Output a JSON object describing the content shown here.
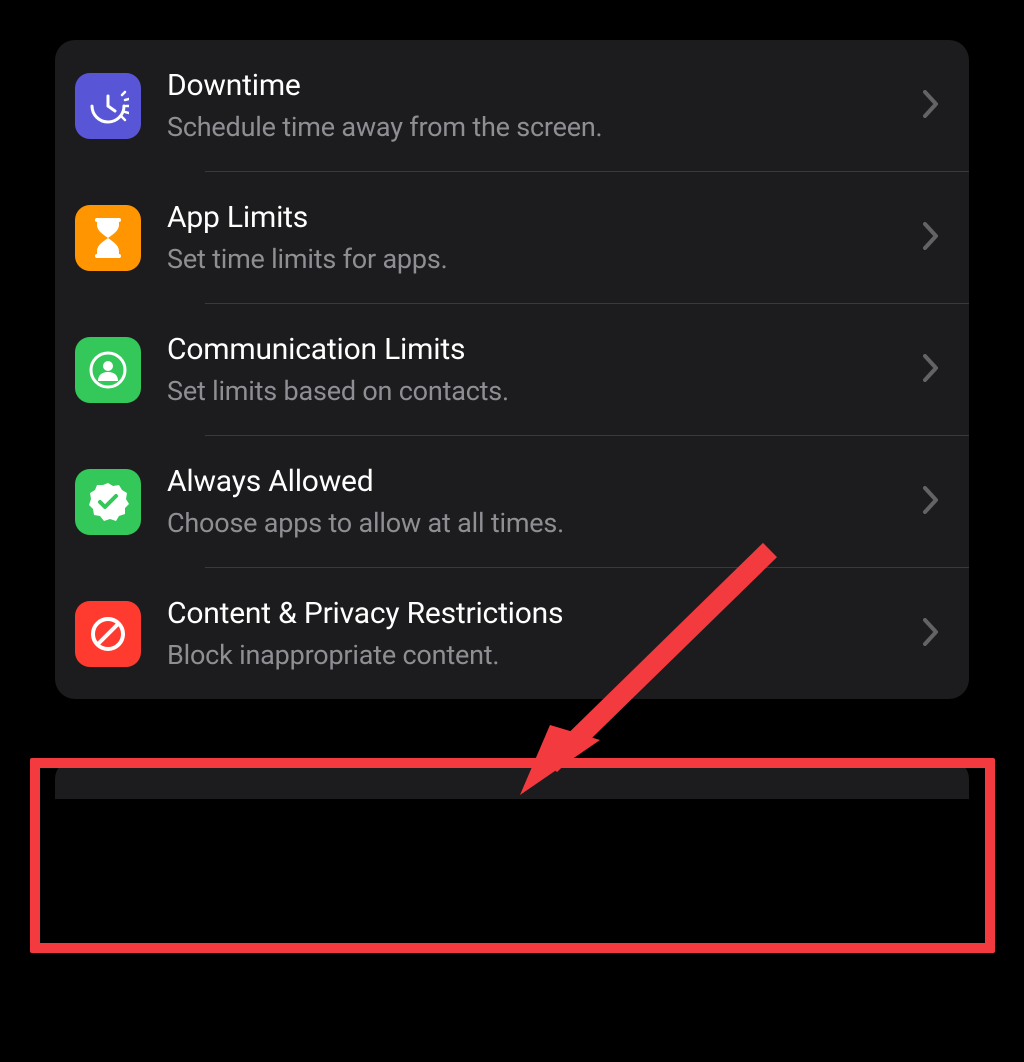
{
  "rows": [
    {
      "title": "Downtime",
      "subtitle": "Schedule time away from the screen.",
      "icon_name": "downtime-icon",
      "icon_color": "#5856d6"
    },
    {
      "title": "App Limits",
      "subtitle": "Set time limits for apps.",
      "icon_name": "hourglass-icon",
      "icon_color": "#ff9500"
    },
    {
      "title": "Communication Limits",
      "subtitle": "Set limits based on contacts.",
      "icon_name": "person-circle-icon",
      "icon_color": "#34c759"
    },
    {
      "title": "Always Allowed",
      "subtitle": "Choose apps to allow at all times.",
      "icon_name": "checkmark-seal-icon",
      "icon_color": "#34c759"
    },
    {
      "title": "Content & Privacy Restrictions",
      "subtitle": "Block inappropriate content.",
      "icon_name": "no-symbol-icon",
      "icon_color": "#ff3b30"
    }
  ],
  "annotation": {
    "highlight_color": "#f33b3f",
    "highlighted_row_index": 4
  }
}
